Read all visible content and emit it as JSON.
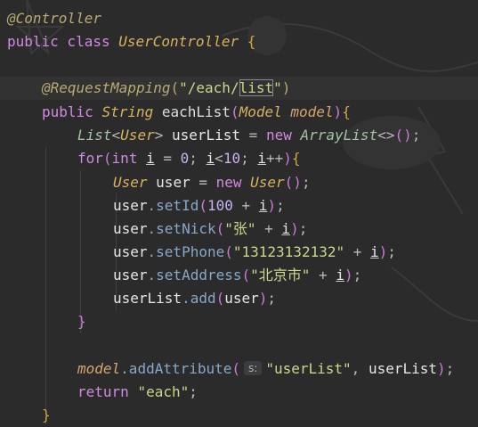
{
  "editor": {
    "lines": [
      {
        "segments": [
          {
            "text": "@Controller",
            "cls": "ann"
          }
        ]
      },
      {
        "segments": [
          {
            "text": "public class ",
            "cls": "kw"
          },
          {
            "text": "UserController",
            "cls": "cls"
          },
          {
            "text": " {",
            "cls": "brace"
          }
        ]
      },
      {
        "segments": []
      },
      {
        "segments": [
          {
            "text": "@RequestMapping",
            "cls": "ann"
          },
          {
            "text": "(",
            "cls": "annp"
          },
          {
            "text": "\"/each/",
            "cls": "str"
          },
          {
            "text": "list",
            "cls": "str",
            "box": true
          },
          {
            "text": "\"",
            "cls": "str"
          },
          {
            "text": ")",
            "cls": "annp"
          }
        ]
      },
      {
        "segments": [
          {
            "text": "public ",
            "cls": "kw"
          },
          {
            "text": "String ",
            "cls": "cls"
          },
          {
            "text": "eachList",
            "cls": "fn"
          },
          {
            "text": "(",
            "cls": "par"
          },
          {
            "text": "Model ",
            "cls": "cls"
          },
          {
            "text": "model",
            "cls": "param"
          },
          {
            "text": ")",
            "cls": "par"
          },
          {
            "text": "{",
            "cls": "brace"
          }
        ]
      },
      {
        "segments": [
          {
            "text": "List",
            "cls": "iface"
          },
          {
            "text": "<",
            "cls": "op"
          },
          {
            "text": "User",
            "cls": "cls"
          },
          {
            "text": "> ",
            "cls": "op"
          },
          {
            "text": "userList ",
            "cls": "var"
          },
          {
            "text": "= ",
            "cls": "op"
          },
          {
            "text": "new ",
            "cls": "kw"
          },
          {
            "text": "ArrayList",
            "cls": "iface"
          },
          {
            "text": "<>",
            "cls": "op"
          },
          {
            "text": "()",
            "cls": "par"
          },
          {
            "text": ";",
            "cls": "op"
          }
        ]
      },
      {
        "segments": [
          {
            "text": "for",
            "cls": "kw"
          },
          {
            "text": "(",
            "cls": "par"
          },
          {
            "text": "int ",
            "cls": "kw"
          },
          {
            "text": "i",
            "cls": "var",
            "u": true
          },
          {
            "text": " = ",
            "cls": "op"
          },
          {
            "text": "0",
            "cls": "num"
          },
          {
            "text": "; ",
            "cls": "op"
          },
          {
            "text": "i",
            "cls": "var",
            "u": true
          },
          {
            "text": "<",
            "cls": "op"
          },
          {
            "text": "10",
            "cls": "num"
          },
          {
            "text": "; ",
            "cls": "op"
          },
          {
            "text": "i",
            "cls": "var",
            "u": true
          },
          {
            "text": "++",
            "cls": "op"
          },
          {
            "text": ")",
            "cls": "par"
          },
          {
            "text": "{",
            "cls": "brace"
          }
        ]
      },
      {
        "segments": [
          {
            "text": "User ",
            "cls": "cls"
          },
          {
            "text": "user ",
            "cls": "var"
          },
          {
            "text": "= ",
            "cls": "op"
          },
          {
            "text": "new ",
            "cls": "kw"
          },
          {
            "text": "User",
            "cls": "cls"
          },
          {
            "text": "()",
            "cls": "par"
          },
          {
            "text": ";",
            "cls": "op"
          }
        ]
      },
      {
        "segments": [
          {
            "text": "user",
            "cls": "var"
          },
          {
            "text": ".setId",
            "cls": "mem"
          },
          {
            "text": "(",
            "cls": "par"
          },
          {
            "text": "100",
            "cls": "num"
          },
          {
            "text": " + ",
            "cls": "op"
          },
          {
            "text": "i",
            "cls": "var",
            "u": true
          },
          {
            "text": ")",
            "cls": "par"
          },
          {
            "text": ";",
            "cls": "op"
          }
        ]
      },
      {
        "segments": [
          {
            "text": "user",
            "cls": "var"
          },
          {
            "text": ".setNick",
            "cls": "mem"
          },
          {
            "text": "(",
            "cls": "par"
          },
          {
            "text": "\"张\"",
            "cls": "str"
          },
          {
            "text": " + ",
            "cls": "op"
          },
          {
            "text": "i",
            "cls": "var",
            "u": true
          },
          {
            "text": ")",
            "cls": "par"
          },
          {
            "text": ";",
            "cls": "op"
          }
        ]
      },
      {
        "segments": [
          {
            "text": "user",
            "cls": "var"
          },
          {
            "text": ".setPhone",
            "cls": "mem"
          },
          {
            "text": "(",
            "cls": "par"
          },
          {
            "text": "\"13123132132\"",
            "cls": "str"
          },
          {
            "text": " + ",
            "cls": "op"
          },
          {
            "text": "i",
            "cls": "var",
            "u": true
          },
          {
            "text": ")",
            "cls": "par"
          },
          {
            "text": ";",
            "cls": "op"
          }
        ]
      },
      {
        "segments": [
          {
            "text": "user",
            "cls": "var"
          },
          {
            "text": ".setAddress",
            "cls": "mem"
          },
          {
            "text": "(",
            "cls": "par"
          },
          {
            "text": "\"北京市\"",
            "cls": "str"
          },
          {
            "text": " + ",
            "cls": "op"
          },
          {
            "text": "i",
            "cls": "var",
            "u": true
          },
          {
            "text": ")",
            "cls": "par"
          },
          {
            "text": ";",
            "cls": "op"
          }
        ]
      },
      {
        "segments": [
          {
            "text": "userList",
            "cls": "var"
          },
          {
            "text": ".add",
            "cls": "mem"
          },
          {
            "text": "(",
            "cls": "par"
          },
          {
            "text": "user",
            "cls": "var"
          },
          {
            "text": ")",
            "cls": "par"
          },
          {
            "text": ";",
            "cls": "op"
          }
        ]
      },
      {
        "segments": [
          {
            "text": "}",
            "cls": "par"
          }
        ]
      },
      {
        "segments": []
      },
      {
        "segments": [
          {
            "text": "model",
            "cls": "param"
          },
          {
            "text": ".addAttribute",
            "cls": "mem"
          },
          {
            "text": "(",
            "cls": "par"
          },
          {
            "hint": "s:"
          },
          {
            "text": "\"userList\"",
            "cls": "str"
          },
          {
            "text": ", ",
            "cls": "op"
          },
          {
            "text": "userList",
            "cls": "var"
          },
          {
            "text": ")",
            "cls": "par"
          },
          {
            "text": ";",
            "cls": "op"
          }
        ]
      },
      {
        "segments": [
          {
            "text": "return ",
            "cls": "kw"
          },
          {
            "text": "\"each\"",
            "cls": "str"
          },
          {
            "text": ";",
            "cls": "op"
          }
        ]
      },
      {
        "segments": [
          {
            "text": "}",
            "cls": "brace"
          }
        ]
      }
    ]
  }
}
